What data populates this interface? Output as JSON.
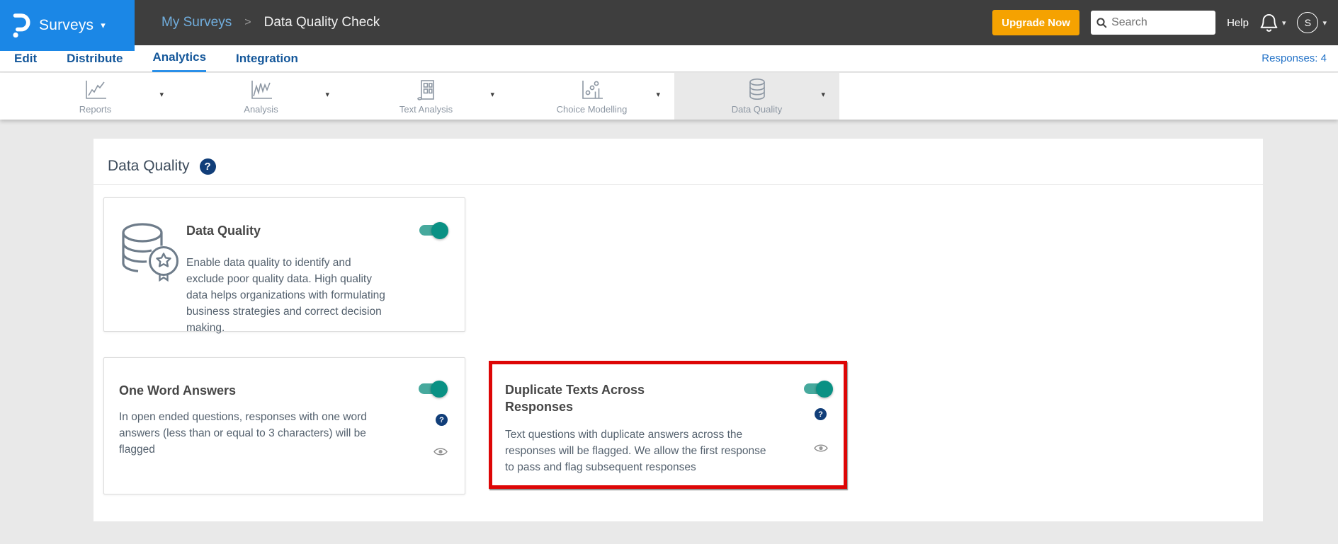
{
  "icons": {
    "chevron_down": "▾",
    "breadcrumb_separator": ">",
    "question_mark": "?"
  },
  "colors": {
    "brand_blue": "#1b87e6",
    "header_dark": "#3e3e3e",
    "upgrade_orange": "#f5a201",
    "nav_blue": "#14579a",
    "toggle_track": "#46a99d",
    "toggle_knob": "#0a9184",
    "help_navy": "#113e79",
    "highlight_red": "#dd0606"
  },
  "header": {
    "product_label": "Surveys",
    "breadcrumb": {
      "parent": "My Surveys",
      "current": "Data Quality Check"
    },
    "upgrade_label": "Upgrade Now",
    "search_placeholder": "Search",
    "help_label": "Help",
    "avatar_initial": "S"
  },
  "nav": {
    "items": [
      {
        "label": "Edit"
      },
      {
        "label": "Distribute"
      },
      {
        "label": "Analytics"
      },
      {
        "label": "Integration"
      }
    ],
    "active_label": "Analytics",
    "responses_label": "Responses: 4"
  },
  "subnav": {
    "items": [
      {
        "label": "Reports",
        "icon": "line-chart-icon"
      },
      {
        "label": "Analysis",
        "icon": "trend-chart-icon"
      },
      {
        "label": "Text Analysis",
        "icon": "text-report-icon"
      },
      {
        "label": "Choice Modelling",
        "icon": "bubble-chart-icon"
      },
      {
        "label": "Data Quality",
        "icon": "database-icon"
      }
    ],
    "active_label": "Data Quality"
  },
  "main": {
    "title": "Data Quality",
    "cards": {
      "data_quality": {
        "title": "Data Quality",
        "toggle": "on",
        "description": "Enable data quality to identify and exclude poor quality data. High quality data helps organizations with formulating business strategies and correct decision making."
      },
      "one_word": {
        "title": "One Word Answers",
        "toggle": "on",
        "description": "In open ended questions, responses with one word answers (less than or equal to 3 characters) will be flagged"
      },
      "duplicate": {
        "title": "Duplicate Texts Across Responses",
        "toggle": "on",
        "highlighted": true,
        "description": "Text questions with duplicate answers across the responses will be flagged. We allow the first response to pass and flag subsequent responses"
      }
    }
  }
}
